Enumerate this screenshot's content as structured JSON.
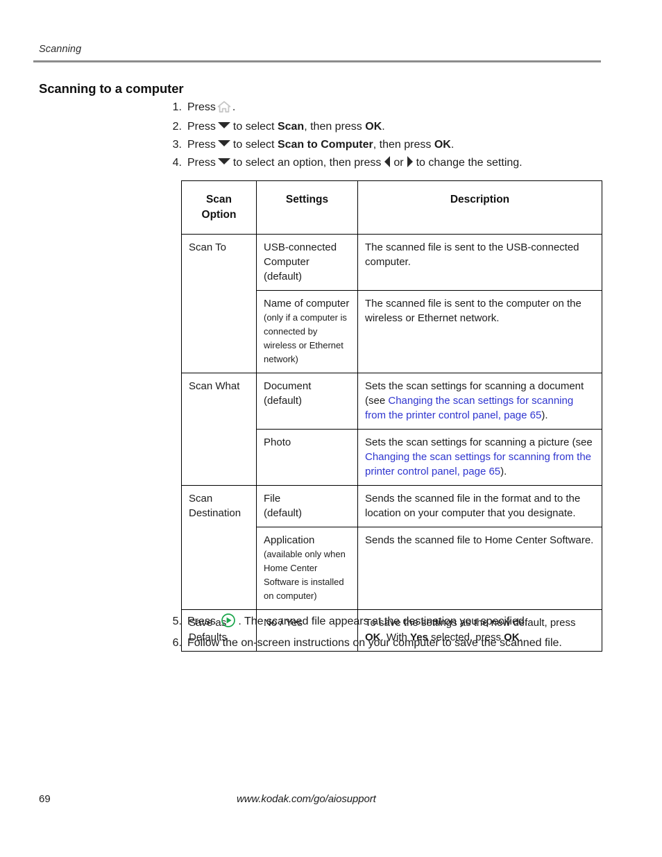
{
  "header": {
    "running_head": "Scanning",
    "rule_color": "#8c8c8c"
  },
  "section": {
    "heading": "Scanning to a computer"
  },
  "steps_top": [
    {
      "num": "1.",
      "pre": "Press",
      "icon": "home-icon",
      "post": "."
    },
    {
      "num": "2.",
      "pre": "Press",
      "icon": "down-arrow-icon",
      "mid": "to select",
      "bold1": "Scan",
      "mid2": ", then press",
      "bold2": "OK",
      "post": "."
    },
    {
      "num": "3.",
      "pre": "Press",
      "icon": "down-arrow-icon",
      "mid": "to select",
      "bold1": "Scan to Computer",
      "mid2": ", then press",
      "bold2": "OK",
      "post": "."
    },
    {
      "num": "4.",
      "pre": "Press",
      "icon": "down-arrow-icon",
      "mid": "to select an option, then press",
      "icon2": "left-arrow-icon",
      "or": "or",
      "icon3": "right-arrow-icon",
      "post": "to change the setting."
    }
  ],
  "steps_bottom": [
    {
      "num": "5.",
      "pre": "Press",
      "icon": "play-button-icon",
      "post": ". The scanned file appears at the destination you specified."
    },
    {
      "num": "6.",
      "text": "Follow the on-screen instructions on your computer to save the scanned file."
    }
  ],
  "table": {
    "headers": {
      "option": "Scan\nOption",
      "option_line1": "Scan",
      "option_line2": "Option",
      "settings": "Settings",
      "description": "Description"
    },
    "rows": [
      {
        "option": "Scan To",
        "settings_main": "USB-connected\nComputer\n(default)",
        "settings_line1": "USB-connected",
        "settings_line2": "Computer",
        "settings_line3": "(default)",
        "description": "The scanned file is sent to the USB-connected computer."
      },
      {
        "option": "",
        "settings_line1": "Name of computer",
        "settings_note": "(only if a computer is connected by wireless or Ethernet network)",
        "description": "The scanned file is sent to the computer on the wireless or Ethernet network."
      },
      {
        "option": "Scan What",
        "settings_line1": "Document",
        "settings_line2": "(default)",
        "desc_pre": "Sets the scan settings for scanning a document (see ",
        "desc_link": "Changing the scan settings for scanning from the printer control panel, page 65",
        "desc_post": ")."
      },
      {
        "option": "",
        "settings_line1": "Photo",
        "desc_pre": "Sets the scan settings for scanning a picture (see ",
        "desc_link": "Changing the scan settings for scanning from the printer control panel, page 65",
        "desc_post": ")."
      },
      {
        "option": "Scan\nDestination",
        "option_line1": "Scan",
        "option_line2": "Destination",
        "settings_line1": "File",
        "settings_line2": "(default)",
        "description": "Sends the scanned file in the format and to the location on your computer that you designate."
      },
      {
        "option": "",
        "settings_line1": "Application",
        "settings_note": "(available only when Home Center Software is installed on computer)",
        "description": "Sends the scanned file to Home Center Software."
      },
      {
        "option_line1": "Save as",
        "option_line2": "Defaults",
        "settings_line1": "No / Yes",
        "desc_pre": "To save the settings as the new default, press ",
        "desc_bold1": "OK",
        "desc_mid1": ". With ",
        "desc_bold2": "Yes",
        "desc_mid2": " selected, press ",
        "desc_bold3": "OK",
        "desc_post": "."
      }
    ]
  },
  "footer": {
    "page_number": "69",
    "url": "www.kodak.com/go/aiosupport"
  },
  "colors": {
    "link": "#2f35cf",
    "play_green": "#1aa64b",
    "home_gray": "#c9c9c9",
    "rule": "#8c8c8c"
  }
}
